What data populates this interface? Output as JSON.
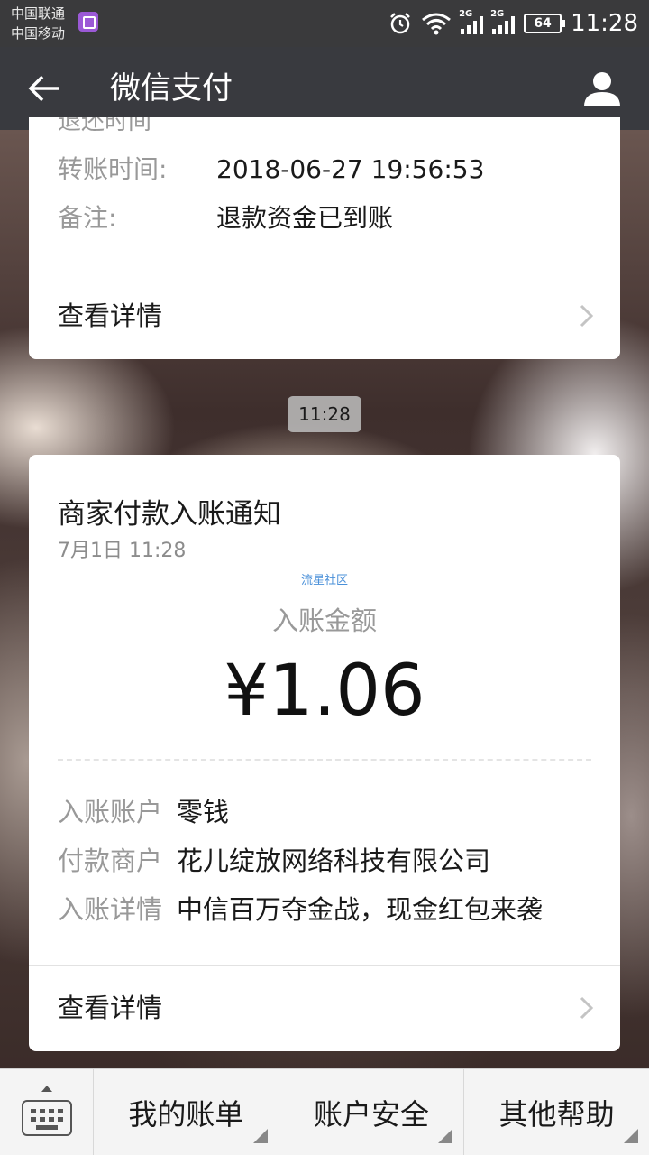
{
  "status_bar": {
    "carrier_1": "中国联通",
    "carrier_2": "中国移动",
    "network_1": "2G",
    "network_2": "2G",
    "battery": "64",
    "time": "11:28"
  },
  "nav": {
    "title": "微信支付"
  },
  "previous_card": {
    "partial_label": "退还时间",
    "transfer_time_label": "转账时间:",
    "transfer_time_value": "2018-06-27 19:56:53",
    "note_label": "备注:",
    "note_value": "退款资金已到账",
    "details_label": "查看详情"
  },
  "time_separator": "11:28",
  "notice_card": {
    "title": "商家付款入账通知",
    "date": "7月1日  11:28",
    "watermark": "流星社区",
    "amount_label": "入账金额",
    "amount": "¥1.06",
    "account_label": "入账账户",
    "account_value": "零钱",
    "merchant_label": "付款商户",
    "merchant_value": "花儿绽放网络科技有限公司",
    "detail_label": "入账详情",
    "detail_value": "中信百万夺金战，现金红包来袭",
    "details_label": "查看详情"
  },
  "bottom_menu": {
    "item_1": "我的账单",
    "item_2": "账户安全",
    "item_3": "其他帮助"
  }
}
